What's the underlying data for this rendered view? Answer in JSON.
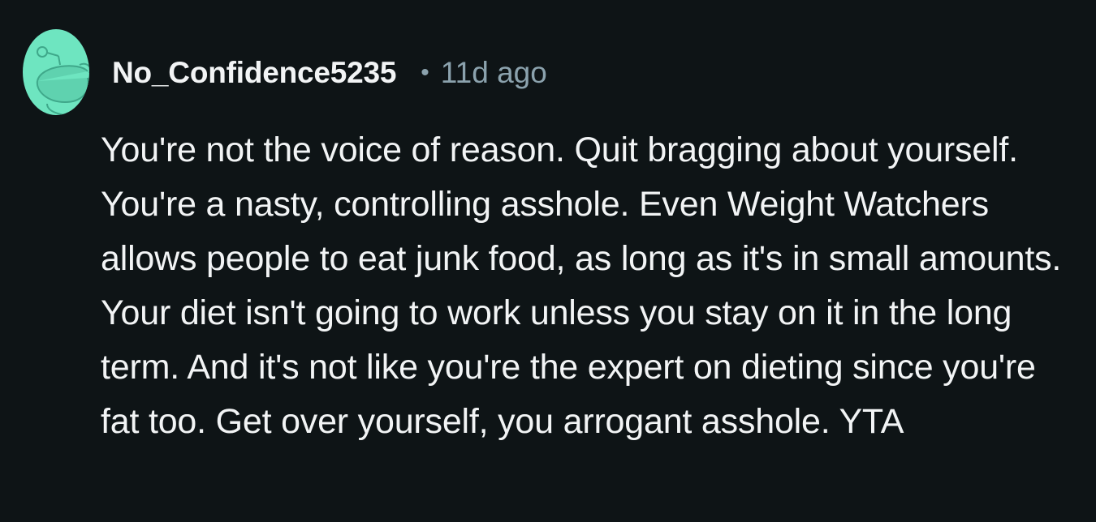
{
  "comment": {
    "author": "No_Confidence5235",
    "separator": "•",
    "timestamp": "11d ago",
    "avatar_icon": "reddit-snoo-avatar-icon",
    "avatar_color": "#6ee5c0",
    "body": "You're not the voice of reason. Quit bragging about yourself. You're a nasty, controlling asshole. Even Weight Watchers allows people to eat junk food, as long as it's in small amounts. Your diet isn't going to work unless you stay on it in the long term. And it's not like you're the expert on dieting since you're fat too. Get over yourself, you arrogant asshole. YTA"
  },
  "colors": {
    "background": "#0e1416",
    "text": "#f2f4f5",
    "meta": "#8ba2ad"
  }
}
